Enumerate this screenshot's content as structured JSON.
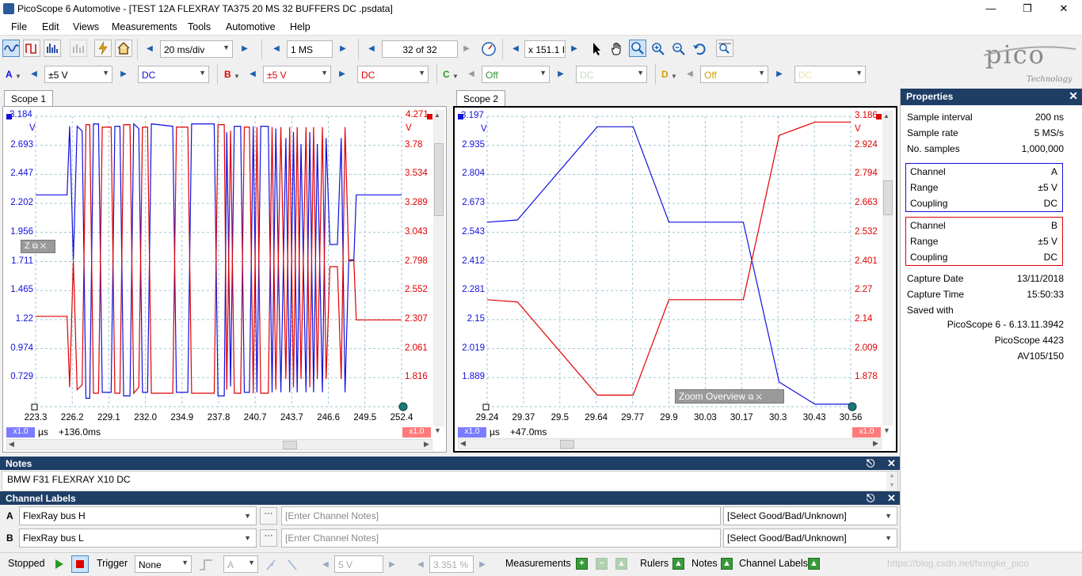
{
  "window": {
    "title": "PicoScope 6 Automotive - [TEST 12A FLEXRAY TA375 20 MS 32 BUFFERS DC .psdata]"
  },
  "menu": [
    "File",
    "Edit",
    "Views",
    "Measurements",
    "Tools",
    "Automotive",
    "Help"
  ],
  "toolbar": {
    "timebase": "20 ms/div",
    "samples": "1 MS",
    "buffer": "32 of 32",
    "zoom": "x 151.1 I"
  },
  "channels": [
    {
      "letter": "A",
      "range": "±5 V",
      "coupling": "DC",
      "color": "#1010e0"
    },
    {
      "letter": "B",
      "range": "±5 V",
      "coupling": "DC",
      "color": "#e00000"
    },
    {
      "letter": "C",
      "range": "Off",
      "coupling": "DC",
      "color": "#2e9a2e"
    },
    {
      "letter": "D",
      "range": "Off",
      "coupling": "DC",
      "color": "#d4a000"
    }
  ],
  "logo": {
    "text": "pico",
    "sub": "Technology"
  },
  "scope1": {
    "tab": "Scope 1",
    "y_left_top": "3.184",
    "y_left_unit": "V",
    "y_right_top": "4.271",
    "y_right_unit": "V",
    "y_left_ticks": [
      "2.693",
      "2.447",
      "2.202",
      "1.956",
      "1.711",
      "1.465",
      "1.22",
      "0.974",
      "0.729"
    ],
    "y_right_ticks": [
      "3.78",
      "3.534",
      "3.289",
      "3.043",
      "2.798",
      "2.552",
      "2.307",
      "2.061",
      "1.816"
    ],
    "x_ticks": [
      "223.3",
      "226.2",
      "229.1",
      "232.0",
      "234.9",
      "237.8",
      "240.7",
      "243.7",
      "246.6",
      "249.5",
      "252.4"
    ],
    "x_unit": "µs",
    "offset": "+136.0ms",
    "scale_left": "x1.0",
    "scale_right": "x1.0",
    "zoom_tag": "Z"
  },
  "scope2": {
    "tab": "Scope 2",
    "y_left_top": "3.197",
    "y_left_unit": "V",
    "y_right_top": "3.186",
    "y_right_unit": "V",
    "y_left_ticks": [
      "2.935",
      "2.804",
      "2.673",
      "2.543",
      "2.412",
      "2.281",
      "2.15",
      "2.019",
      "1.889"
    ],
    "y_right_ticks": [
      "2.924",
      "2.794",
      "2.663",
      "2.532",
      "2.401",
      "2.27",
      "2.14",
      "2.009",
      "1.878"
    ],
    "x_ticks": [
      "29.24",
      "29.37",
      "29.5",
      "29.64",
      "29.77",
      "29.9",
      "30.03",
      "30.17",
      "30.3",
      "30.43",
      "30.56"
    ],
    "x_unit": "µs",
    "offset": "+47.0ms",
    "scale_left": "x1.0",
    "scale_right": "x1.0",
    "zoom_overview": "Zoom Overview"
  },
  "chart_data": [
    {
      "type": "line",
      "title": "Scope 1",
      "xlabel": "µs",
      "x_range": [
        223.3,
        252.4
      ],
      "series": [
        {
          "name": "A",
          "color": "#1010e0",
          "values": [
            [
              223.3,
              2.52
            ],
            [
              225.8,
              2.52
            ],
            [
              226.0,
              3.1
            ],
            [
              226.3,
              1.97
            ],
            [
              226.6,
              3.1
            ],
            [
              227.0,
              3.06
            ],
            [
              227.3,
              0.8
            ],
            [
              227.6,
              0.8
            ],
            [
              227.9,
              3.12
            ],
            [
              228.3,
              3.12
            ],
            [
              228.6,
              0.85
            ],
            [
              229.3,
              0.85
            ],
            [
              229.6,
              3.1
            ],
            [
              230.0,
              3.1
            ],
            [
              230.3,
              0.82
            ],
            [
              230.8,
              0.82
            ],
            [
              231.1,
              3.12
            ],
            [
              231.5,
              3.08
            ],
            [
              231.8,
              0.85
            ],
            [
              232.2,
              0.85
            ],
            [
              232.5,
              3.12
            ],
            [
              234.2,
              3.1
            ],
            [
              234.5,
              0.85
            ],
            [
              235.4,
              0.85
            ],
            [
              235.7,
              3.12
            ],
            [
              237.5,
              3.12
            ],
            [
              237.8,
              0.82
            ],
            [
              238.3,
              0.82
            ],
            [
              238.5,
              3.05
            ],
            [
              238.8,
              0.9
            ],
            [
              239.1,
              3.1
            ],
            [
              239.6,
              3.1
            ],
            [
              239.9,
              0.85
            ],
            [
              240.3,
              0.85
            ],
            [
              240.6,
              3.1
            ],
            [
              240.9,
              0.85
            ],
            [
              241.2,
              3.1
            ],
            [
              241.8,
              3.1
            ],
            [
              242.1,
              0.85
            ],
            [
              242.4,
              3.08
            ],
            [
              242.8,
              0.85
            ],
            [
              243.2,
              3.0
            ],
            [
              243.5,
              0.85
            ],
            [
              243.8,
              3.05
            ],
            [
              244.1,
              0.85
            ],
            [
              244.4,
              2.95
            ],
            [
              244.8,
              0.85
            ],
            [
              245.1,
              3.05
            ],
            [
              245.4,
              0.85
            ],
            [
              245.7,
              2.95
            ],
            [
              246.1,
              0.85
            ],
            [
              246.4,
              3.0
            ],
            [
              246.7,
              2.1
            ],
            [
              247.3,
              2.1
            ],
            [
              247.6,
              3.0
            ],
            [
              247.9,
              0.85
            ],
            [
              248.2,
              1.97
            ],
            [
              248.6,
              1.97
            ],
            [
              248.8,
              2.52
            ],
            [
              252.4,
              2.52
            ]
          ]
        },
        {
          "name": "B",
          "color": "#e00000",
          "values": [
            [
              223.3,
              2.58
            ],
            [
              225.8,
              2.58
            ],
            [
              226.0,
              1.98
            ],
            [
              226.3,
              3.05
            ],
            [
              226.6,
              1.96
            ],
            [
              227.0,
              2.0
            ],
            [
              227.3,
              4.2
            ],
            [
              227.6,
              4.2
            ],
            [
              227.9,
              1.93
            ],
            [
              228.3,
              1.93
            ],
            [
              228.6,
              4.18
            ],
            [
              229.3,
              4.18
            ],
            [
              229.6,
              1.93
            ],
            [
              230.0,
              1.93
            ],
            [
              230.3,
              4.2
            ],
            [
              230.8,
              4.2
            ],
            [
              231.1,
              1.93
            ],
            [
              231.5,
              1.98
            ],
            [
              231.8,
              4.18
            ],
            [
              232.2,
              4.18
            ],
            [
              232.5,
              1.93
            ],
            [
              234.2,
              1.93
            ],
            [
              234.5,
              4.18
            ],
            [
              235.4,
              4.18
            ],
            [
              235.7,
              1.93
            ],
            [
              237.5,
              1.93
            ],
            [
              237.8,
              4.2
            ],
            [
              238.3,
              4.2
            ],
            [
              238.5,
              1.96
            ],
            [
              238.8,
              4.15
            ],
            [
              239.1,
              1.93
            ],
            [
              239.6,
              1.93
            ],
            [
              239.9,
              4.18
            ],
            [
              240.3,
              4.18
            ],
            [
              240.6,
              1.93
            ],
            [
              240.9,
              4.18
            ],
            [
              241.2,
              1.93
            ],
            [
              241.8,
              1.93
            ],
            [
              242.1,
              4.18
            ],
            [
              242.4,
              1.96
            ],
            [
              242.8,
              4.18
            ],
            [
              243.2,
              2.05
            ],
            [
              243.5,
              4.18
            ],
            [
              243.8,
              1.98
            ],
            [
              244.1,
              4.18
            ],
            [
              244.4,
              2.05
            ],
            [
              244.8,
              4.18
            ],
            [
              245.1,
              1.98
            ],
            [
              245.4,
              4.18
            ],
            [
              245.7,
              2.05
            ],
            [
              246.1,
              4.18
            ],
            [
              246.4,
              2.05
            ],
            [
              246.7,
              3.0
            ],
            [
              247.3,
              3.0
            ],
            [
              247.6,
              2.05
            ],
            [
              247.9,
              4.18
            ],
            [
              248.2,
              3.05
            ],
            [
              248.6,
              3.05
            ],
            [
              248.8,
              2.55
            ],
            [
              252.4,
              2.55
            ]
          ]
        }
      ]
    },
    {
      "type": "line",
      "title": "Scope 2",
      "xlabel": "µs",
      "x_range": [
        29.24,
        30.56
      ],
      "series": [
        {
          "name": "A",
          "color": "#1010e0",
          "values": [
            [
              29.24,
              2.72
            ],
            [
              29.35,
              2.73
            ],
            [
              29.64,
              3.15
            ],
            [
              29.77,
              3.15
            ],
            [
              29.9,
              2.72
            ],
            [
              30.03,
              2.72
            ],
            [
              30.17,
              2.72
            ],
            [
              30.3,
              2.0
            ],
            [
              30.43,
              1.9
            ],
            [
              30.56,
              1.9
            ]
          ]
        },
        {
          "name": "B",
          "color": "#e00000",
          "values": [
            [
              29.24,
              2.36
            ],
            [
              29.35,
              2.35
            ],
            [
              29.64,
              1.93
            ],
            [
              29.77,
              1.93
            ],
            [
              29.9,
              2.36
            ],
            [
              30.03,
              2.36
            ],
            [
              30.17,
              2.36
            ],
            [
              30.3,
              3.1
            ],
            [
              30.43,
              3.16
            ],
            [
              30.56,
              3.16
            ]
          ]
        }
      ]
    }
  ],
  "properties": {
    "title": "Properties",
    "sample_interval_label": "Sample interval",
    "sample_interval": "200 ns",
    "sample_rate_label": "Sample rate",
    "sample_rate": "5 MS/s",
    "no_samples_label": "No. samples",
    "no_samples": "1,000,000",
    "chA": {
      "channel_label": "Channel",
      "channel": "A",
      "range_label": "Range",
      "range": "±5 V",
      "coupling_label": "Coupling",
      "coupling": "DC"
    },
    "chB": {
      "channel_label": "Channel",
      "channel": "B",
      "range_label": "Range",
      "range": "±5 V",
      "coupling_label": "Coupling",
      "coupling": "DC"
    },
    "capture_date_label": "Capture Date",
    "capture_date": "13/11/2018",
    "capture_time_label": "Capture Time",
    "capture_time": "15:50:33",
    "saved_with_label": "Saved with",
    "saved_with_1": "PicoScope 6 - 6.13.11.3942",
    "saved_with_2": "PicoScope 4423",
    "saved_with_3": "AV105/150"
  },
  "notes": {
    "title": "Notes",
    "text": "BMW F31 FLEXRAY X10 DC"
  },
  "channel_labels": {
    "title": "Channel Labels",
    "rows": [
      {
        "letter": "A",
        "label": "FlexRay bus H",
        "notes_placeholder": "[Enter Channel Notes]",
        "status": "[Select Good/Bad/Unknown]"
      },
      {
        "letter": "B",
        "label": "FlexRay bus L",
        "notes_placeholder": "[Enter Channel Notes]",
        "status": "[Select Good/Bad/Unknown]"
      }
    ]
  },
  "status": {
    "state": "Stopped",
    "trigger_label": "Trigger",
    "trigger_mode": "None",
    "trigger_channel": "A",
    "trigger_level": "5 V",
    "trigger_pos": "3.351 %",
    "measurements": "Measurements",
    "rulers": "Rulers",
    "notes": "Notes",
    "channel_labels": "Channel Labels",
    "watermark": "https://blog.csdn.net/hongke_pico"
  }
}
